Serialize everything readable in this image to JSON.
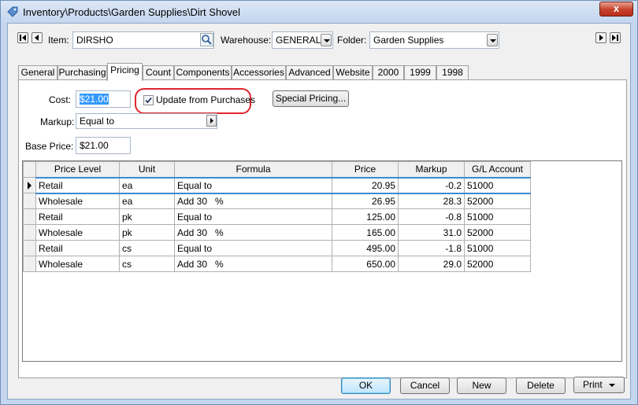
{
  "window": {
    "title": "Inventory\\Products\\Garden Supplies\\Dirt Shovel",
    "close_glyph": "x"
  },
  "header": {
    "item_label": "Item:",
    "item_value": "DIRSHO",
    "warehouse_label": "Warehouse:",
    "warehouse_value": "GENERAL",
    "folder_label": "Folder:",
    "folder_value": "Garden Supplies"
  },
  "tabs": [
    {
      "label": "General"
    },
    {
      "label": "Purchasing"
    },
    {
      "label": "Pricing"
    },
    {
      "label": "Count"
    },
    {
      "label": "Components"
    },
    {
      "label": "Accessories"
    },
    {
      "label": "Advanced"
    },
    {
      "label": "Website"
    },
    {
      "label": "2000"
    },
    {
      "label": "1999"
    },
    {
      "label": "1998"
    }
  ],
  "active_tab": "Pricing",
  "pricing": {
    "cost_label": "Cost:",
    "cost_value": "$21.00",
    "update_checkbox_label": "Update from Purchases",
    "update_checked": true,
    "special_pricing_label": "Special Pricing...",
    "markup_label": "Markup:",
    "markup_value": "Equal to",
    "base_price_label": "Base Price:",
    "base_price_value": "$21.00"
  },
  "price_table": {
    "columns": [
      "Price Level",
      "Unit",
      "Formula",
      "Price",
      "Markup",
      "G/L Account"
    ],
    "rows": [
      {
        "level": "Retail",
        "unit": "ea",
        "formula": "Equal to",
        "pct": "",
        "price": "20.95",
        "markup": "-0.2",
        "gl": "51000"
      },
      {
        "level": "Wholesale",
        "unit": "ea",
        "formula": "Add 30",
        "pct": "%",
        "price": "26.95",
        "markup": "28.3",
        "gl": "52000"
      },
      {
        "level": "Retail",
        "unit": "pk",
        "formula": "Equal to",
        "pct": "",
        "price": "125.00",
        "markup": "-0.8",
        "gl": "51000"
      },
      {
        "level": "Wholesale",
        "unit": "pk",
        "formula": "Add 30",
        "pct": "%",
        "price": "165.00",
        "markup": "31.0",
        "gl": "52000"
      },
      {
        "level": "Retail",
        "unit": "cs",
        "formula": "Equal to",
        "pct": "",
        "price": "495.00",
        "markup": "-1.8",
        "gl": "51000"
      },
      {
        "level": "Wholesale",
        "unit": "cs",
        "formula": "Add 30",
        "pct": "%",
        "price": "650.00",
        "markup": "29.0",
        "gl": "52000"
      }
    ]
  },
  "footer": {
    "ok": "OK",
    "cancel": "Cancel",
    "new": "New",
    "delete": "Delete",
    "print": "Print"
  },
  "colors": {
    "highlight_annotation": "#e0242c",
    "selection": "#3399ff"
  }
}
